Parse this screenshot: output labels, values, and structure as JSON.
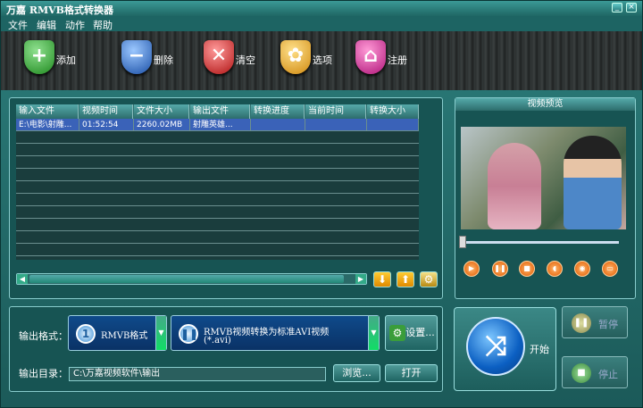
{
  "window": {
    "title": "万嘉 RMVB格式转换器",
    "min": "_",
    "close": "×"
  },
  "menu": [
    "文件",
    "编辑",
    "动作",
    "帮助"
  ],
  "toolbar": [
    {
      "label": "添加",
      "icon": "plus-icon",
      "color": "#2a9d2a",
      "glyph": "+"
    },
    {
      "label": "删除",
      "icon": "minus-icon",
      "color": "#1e62b8",
      "glyph": "−"
    },
    {
      "label": "清空",
      "icon": "x-icon",
      "color": "#c91e1e",
      "glyph": "✕"
    },
    {
      "label": "选项",
      "icon": "gear-icon",
      "color": "#e09a18",
      "glyph": "✿"
    },
    {
      "label": "注册",
      "icon": "basket-icon",
      "color": "#c6208c",
      "glyph": "⌂"
    }
  ],
  "table": {
    "columns": [
      "输入文件",
      "视频时间",
      "文件大小",
      "输出文件",
      "转换进度",
      "当前时间",
      "转换大小"
    ],
    "rows": [
      [
        "E:\\电影\\射雕...",
        "01:52:54",
        "2260.02MB",
        "射雕英雄...",
        "",
        "",
        ""
      ]
    ]
  },
  "preview": {
    "title": "视频预览"
  },
  "output": {
    "format_label": "输出格式：",
    "format_value": "RMVB格式",
    "profile_line1": "RMVB视频转换为标准AVI视频",
    "profile_line2": "(*.avi)",
    "settings": "设置...",
    "dir_label": "输出目录：",
    "dir_value": "C:\\万嘉视频软件\\输出",
    "browse": "浏览...",
    "open": "打开"
  },
  "actions": {
    "start": "开始",
    "pause": "暂停",
    "stop": "停止"
  }
}
